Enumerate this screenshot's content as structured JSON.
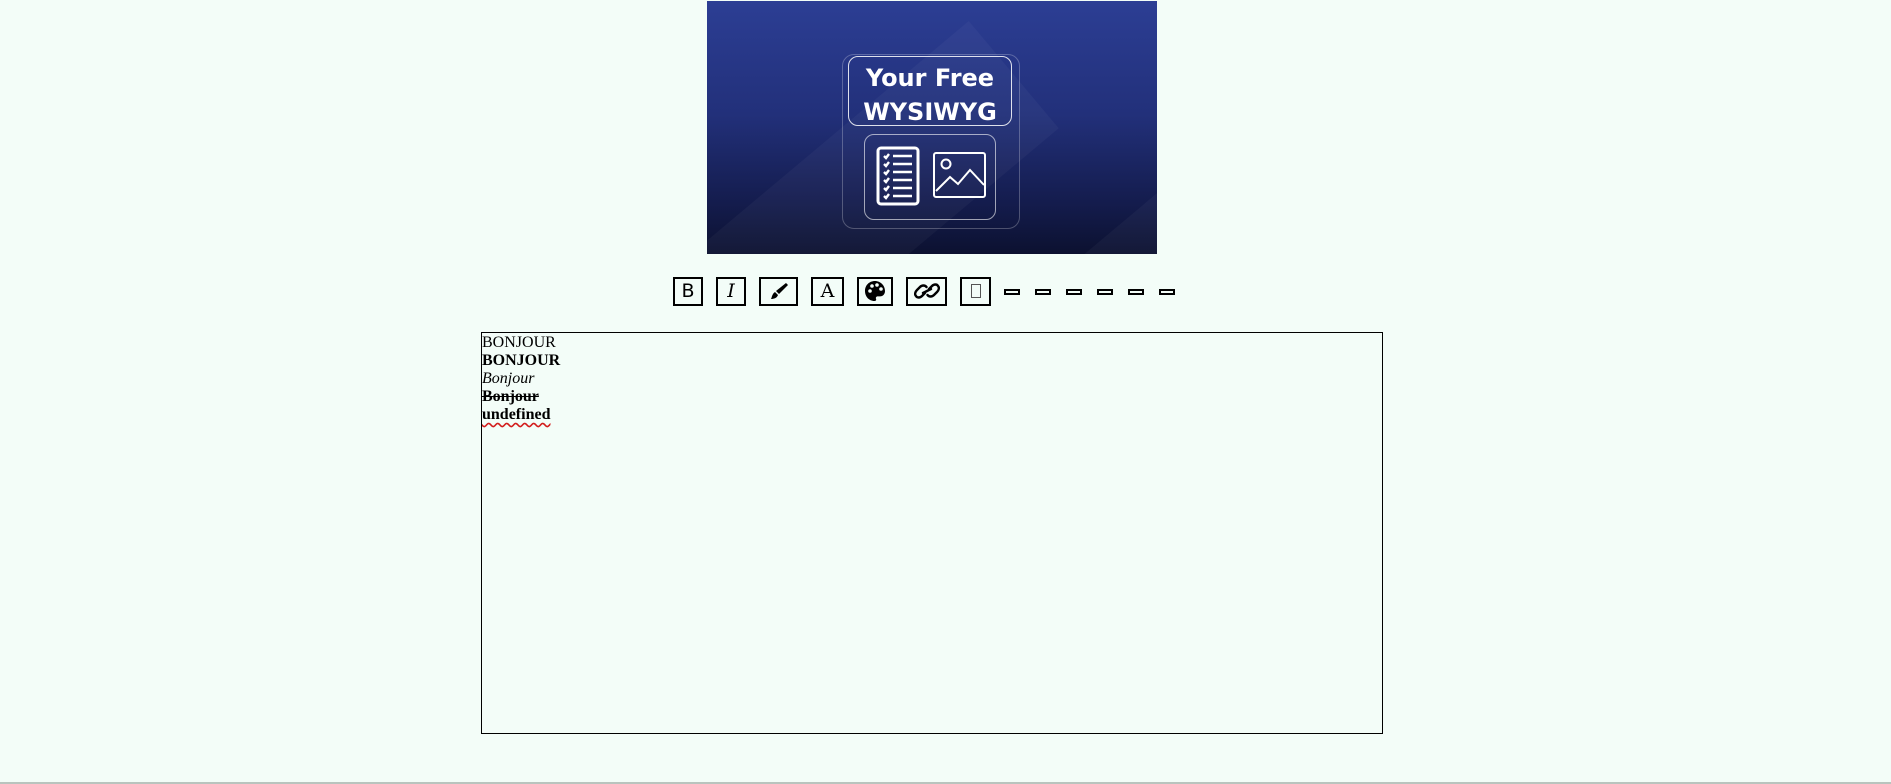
{
  "banner": {
    "title_line1": "Your Free",
    "title_line2": "WYSIWYG",
    "icons": [
      "checklist-document-icon",
      "image-icon"
    ],
    "background_color": "#22307a"
  },
  "toolbar": {
    "buttons": [
      {
        "name": "bold",
        "label": "B",
        "icon": "bold-icon"
      },
      {
        "name": "italic",
        "label": "I",
        "icon": "italic-icon"
      },
      {
        "name": "highlight",
        "icon": "brush-icon"
      },
      {
        "name": "font",
        "label": "A",
        "icon": "font-icon"
      },
      {
        "name": "color",
        "icon": "palette-icon"
      },
      {
        "name": "link",
        "icon": "link-icon"
      },
      {
        "name": "unknown-glyph",
        "icon": "missing-glyph-icon"
      }
    ],
    "dash_buttons_count": 6
  },
  "editor": {
    "lines": [
      {
        "text": "BONJOUR",
        "style": "normal"
      },
      {
        "text": "BONJOUR",
        "style": "bold"
      },
      {
        "text": "Bonjour",
        "style": "italic"
      },
      {
        "text": "Bonjour",
        "style": "strikethrough"
      },
      {
        "text": "undefined",
        "style": "spellcheck"
      }
    ]
  }
}
